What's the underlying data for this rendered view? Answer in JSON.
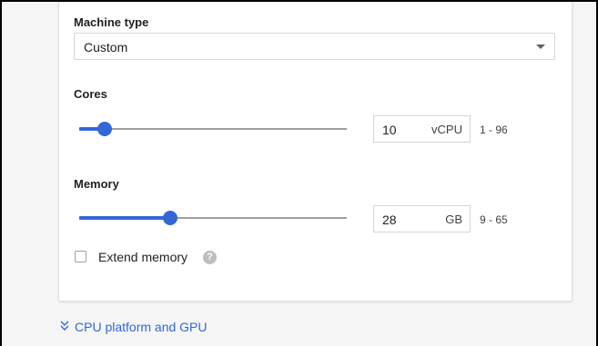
{
  "machine_type": {
    "label": "Machine type",
    "value": "Custom"
  },
  "cores": {
    "label": "Cores",
    "value": "10",
    "unit": "vCPU",
    "range": "1 - 96",
    "min": 1,
    "max": 96,
    "current": 10
  },
  "memory": {
    "label": "Memory",
    "value": "28",
    "unit": "GB",
    "range": "9 - 65",
    "min": 9,
    "max": 65,
    "current": 28
  },
  "extend_memory": {
    "label": "Extend memory",
    "checked": false,
    "help_icon": "help-circle-icon"
  },
  "cpu_platform": {
    "label": "CPU platform and GPU",
    "icon": "double-chevron-down-icon"
  },
  "colors": {
    "accent": "#3367d6",
    "track": "#9e9e9e",
    "link": "#3367d6"
  }
}
